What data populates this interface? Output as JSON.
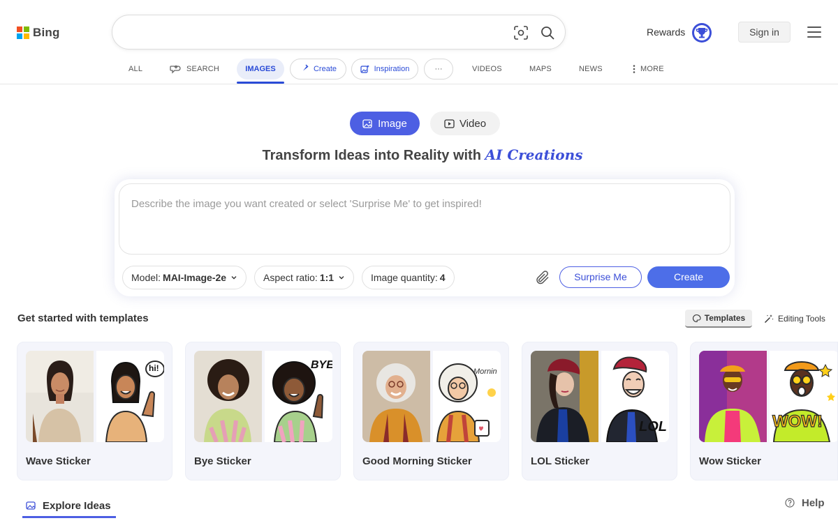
{
  "header": {
    "logo_text": "Bing",
    "search": {
      "value": "",
      "placeholder": ""
    },
    "rewards_label": "Rewards",
    "signin_label": "Sign in"
  },
  "nav": {
    "all": "ALL",
    "search": "SEARCH",
    "images": "IMAGES",
    "create": "Create",
    "inspiration": "Inspiration",
    "more_dots": "···",
    "videos": "VIDEOS",
    "maps": "MAPS",
    "news": "NEWS",
    "more": "MORE"
  },
  "mode": {
    "image": "Image",
    "video": "Video"
  },
  "headline": {
    "text": "Transform Ideas into Reality with ",
    "accent": "AI Creations"
  },
  "prompt": {
    "placeholder": "Describe the image you want created or select 'Surprise Me' to get inspired!",
    "value": ""
  },
  "options": {
    "model_label": "Model:",
    "model_value": "MAI-Image-2e",
    "aspect_label": "Aspect ratio:",
    "aspect_value": "1:1",
    "quantity_label": "Image quantity:",
    "quantity_value": "4"
  },
  "actions": {
    "surprise": "Surprise Me",
    "create": "Create"
  },
  "templates": {
    "title": "Get started with templates",
    "tab_templates": "Templates",
    "tab_editing": "Editing Tools",
    "cards": [
      {
        "name": "Wave Sticker",
        "sticker_text": "hi!"
      },
      {
        "name": "Bye Sticker",
        "sticker_text": "BYE"
      },
      {
        "name": "Good Morning Sticker",
        "sticker_text": "Mornin"
      },
      {
        "name": "LOL Sticker",
        "sticker_text": "LOL"
      },
      {
        "name": "Wow Sticker",
        "sticker_text": "WOW!"
      }
    ]
  },
  "footer": {
    "explore": "Explore Ideas",
    "help": "Help"
  },
  "colors": {
    "accent": "#4d5fe3",
    "accent_text": "#2a4bd7",
    "ms_red": "#f25022",
    "ms_green": "#7fba00",
    "ms_blue": "#00a4ef",
    "ms_yellow": "#ffb900"
  }
}
